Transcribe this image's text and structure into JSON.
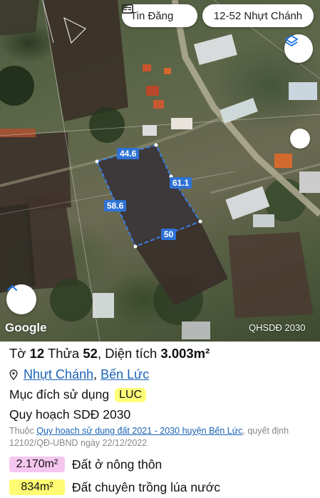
{
  "header": {
    "post_label": "Tin Đăng",
    "location_label": "12-52 Nhựt Chánh"
  },
  "map": {
    "edge_labels": [
      "44.6",
      "61.1",
      "58.6",
      "50"
    ],
    "provider": "Google",
    "layer_label": "QHSDĐ 2030",
    "icons": [
      "newspaper-icon",
      "layers-icon",
      "chevron-up-icon"
    ]
  },
  "parcel": {
    "title_prefix": "Tờ ",
    "sheet": "12",
    "plot_prefix": " Thửa ",
    "plot": "52",
    "area_prefix": ", Diện tích ",
    "area": "3.003m²",
    "ward": "Nhựt Chánh",
    "separator": ", ",
    "district": "Bến Lức",
    "purpose_label": "Mục đích sử dụng",
    "purpose_code": "LUC",
    "plan_label": "Quy hoạch SDĐ 2030",
    "note_prefix": "Thuộc ",
    "note_link": "Quy hoach sử dung đất 2021 - 2030 huyện Bến Lức",
    "note_suffix": ", quyết định 12102/QĐ-UBND ngày 22/12/2022",
    "zones": [
      {
        "area": "2.170m²",
        "label": "Đất ở nông thôn",
        "color": "#f5c6f0"
      },
      {
        "area": "834m²",
        "label": "Đất chuyên trồng lúa nước",
        "color": "#fffb72"
      }
    ]
  }
}
